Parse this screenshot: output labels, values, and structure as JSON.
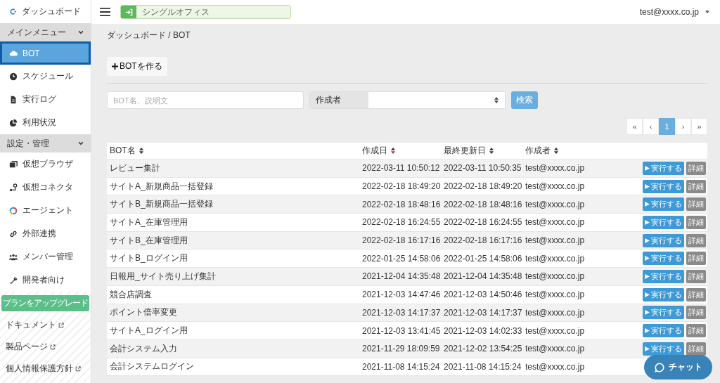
{
  "header": {
    "brand": "ダッシュボード",
    "office": "シングルオフィス",
    "user": "test@xxxx.co.jp"
  },
  "sidebar": {
    "sections": [
      {
        "title": "メインメニュー",
        "expanded": true,
        "items": [
          {
            "label": "BOT",
            "selected": true
          },
          {
            "label": "スケジュール",
            "selected": false
          },
          {
            "label": "実行ログ",
            "selected": false
          },
          {
            "label": "利用状況",
            "selected": false
          }
        ]
      },
      {
        "title": "設定・管理",
        "expanded": true,
        "items": [
          {
            "label": "仮想ブラウザ",
            "selected": false
          },
          {
            "label": "仮想コネクタ",
            "selected": false
          },
          {
            "label": "エージェント",
            "selected": false
          },
          {
            "label": "外部連携",
            "selected": false
          },
          {
            "label": "メンバー管理",
            "selected": false
          },
          {
            "label": "開発者向け",
            "selected": false
          }
        ]
      }
    ],
    "upgrade_button": "プランをアップグレード",
    "links": [
      "ドキュメント",
      "製品ページ",
      "個人情報保護方針"
    ]
  },
  "breadcrumb": "ダッシュボード / BOT",
  "create_button": "BOTを作る",
  "search": {
    "placeholder": "BOT名、説明文",
    "creator_label": "作成者",
    "search_button": "検索"
  },
  "pagination": [
    {
      "label": "«",
      "selected": false
    },
    {
      "label": "‹",
      "selected": false
    },
    {
      "label": "1",
      "selected": true
    },
    {
      "label": "›",
      "selected": false
    },
    {
      "label": "»",
      "selected": false
    }
  ],
  "table": {
    "columns": [
      {
        "label": "BOT名",
        "sorted": false
      },
      {
        "label": "作成日",
        "sorted": true
      },
      {
        "label": "最終更新日",
        "sorted": false
      },
      {
        "label": "作成者",
        "sorted": false
      }
    ],
    "rows": [
      {
        "name": "レビュー集計",
        "created": "2022-03-11 10:50:12",
        "updated": "2022-03-11 10:50:35",
        "creator": "test@xxxx.co.jp",
        "run": "実行する",
        "detail": "詳細"
      },
      {
        "name": "サイトA_新規商品一括登録",
        "created": "2022-02-18 18:49:20",
        "updated": "2022-02-18 18:49:20",
        "creator": "test@xxxx.co.jp",
        "run": "実行する",
        "detail": "詳細"
      },
      {
        "name": "サイトB_新規商品一括登録",
        "created": "2022-02-18 18:48:16",
        "updated": "2022-02-18 18:48:16",
        "creator": "test@xxxx.co.jp",
        "run": "実行する",
        "detail": "詳細"
      },
      {
        "name": "サイトA_在庫管理用",
        "created": "2022-02-18 16:24:55",
        "updated": "2022-02-18 16:24:55",
        "creator": "test@xxxx.co.jp",
        "run": "実行する",
        "detail": "詳細"
      },
      {
        "name": "サイトB_在庫管理用",
        "created": "2022-02-18 16:17:16",
        "updated": "2022-02-18 16:17:16",
        "creator": "test@xxxx.co.jp",
        "run": "実行する",
        "detail": "詳細"
      },
      {
        "name": "サイトB_ログイン用",
        "created": "2022-01-25 14:58:06",
        "updated": "2022-01-25 14:58:06",
        "creator": "test@xxxx.co.jp",
        "run": "実行する",
        "detail": "詳細"
      },
      {
        "name": "日報用_サイト売り上げ集計",
        "created": "2021-12-04 14:35:48",
        "updated": "2021-12-04 14:35:48",
        "creator": "test@xxxx.co.jp",
        "run": "実行する",
        "detail": "詳細"
      },
      {
        "name": "競合店調査",
        "created": "2021-12-03 14:47:46",
        "updated": "2021-12-03 14:50:46",
        "creator": "test@xxxx.co.jp",
        "run": "実行する",
        "detail": "詳細"
      },
      {
        "name": "ポイント倍率変更",
        "created": "2021-12-03 14:17:37",
        "updated": "2021-12-03 14:17:37",
        "creator": "test@xxxx.co.jp",
        "run": "実行する",
        "detail": "詳細"
      },
      {
        "name": "サイトA_ログイン用",
        "created": "2021-12-03 13:41:45",
        "updated": "2021-12-03 14:02:33",
        "creator": "test@xxxx.co.jp",
        "run": "実行する",
        "detail": "詳細"
      },
      {
        "name": "会計システム入力",
        "created": "2021-11-29 18:09:59",
        "updated": "2021-12-02 13:54:25",
        "creator": "test@xxxx.co.jp",
        "run": "実行する",
        "detail": "詳細"
      },
      {
        "name": "会計システムログイン",
        "created": "2021-11-08 14:15:24",
        "updated": "2021-11-08 14:15:24",
        "creator": "test@xxxx.co.jp"
      }
    ]
  },
  "chat_button": "チャット"
}
